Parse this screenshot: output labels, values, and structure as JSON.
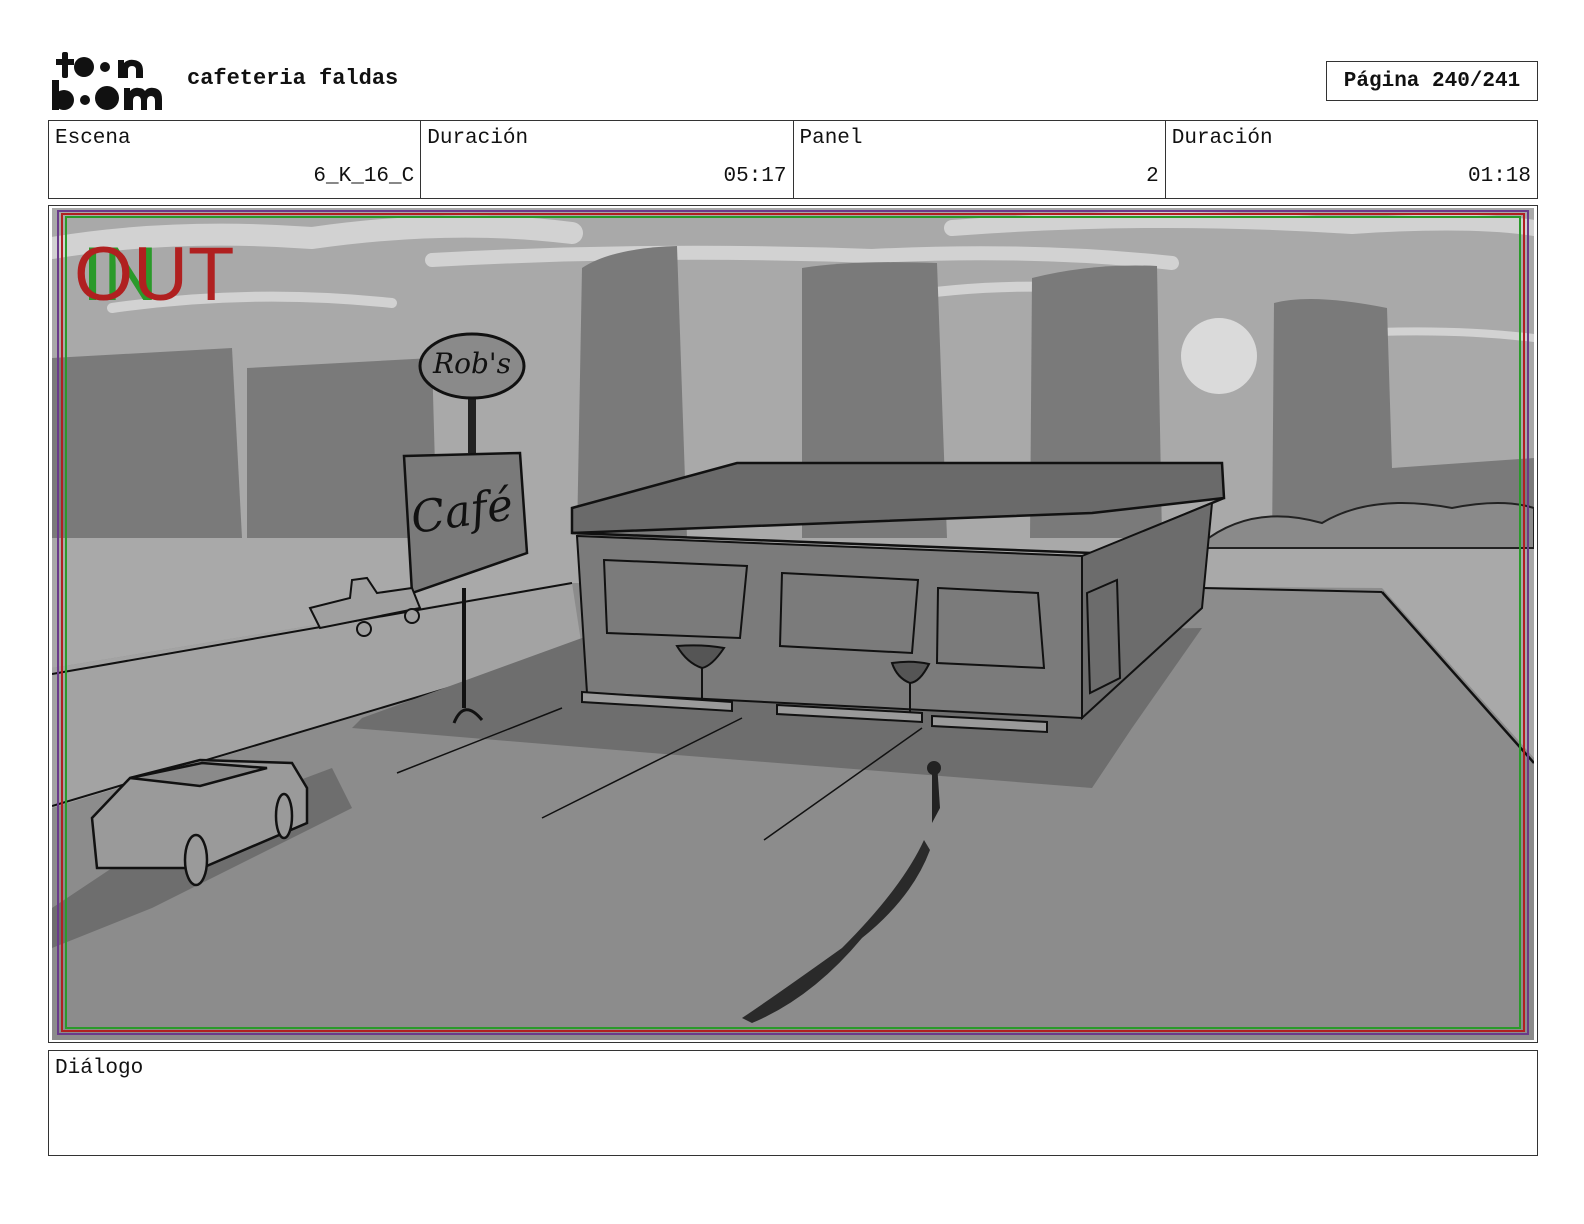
{
  "header": {
    "logo_text": "toon boom",
    "project_title": "cafeteria faldas",
    "page_label": "Página 240/241"
  },
  "info": [
    {
      "label": "Escena",
      "value": "6_K_16_C"
    },
    {
      "label": "Duración",
      "value": "05:17"
    },
    {
      "label": "Panel",
      "value": "2"
    },
    {
      "label": "Duración",
      "value": "01:18"
    }
  ],
  "panel": {
    "overlay_in": "IN",
    "overlay_out": "OUT",
    "sign_top": "Rob's",
    "sign_main": "Café",
    "safe_colors": {
      "red": "#b02020",
      "green": "#2a9a2a",
      "purple": "#6a3a8a"
    }
  },
  "dialog": {
    "label": "Diálogo",
    "text": ""
  }
}
